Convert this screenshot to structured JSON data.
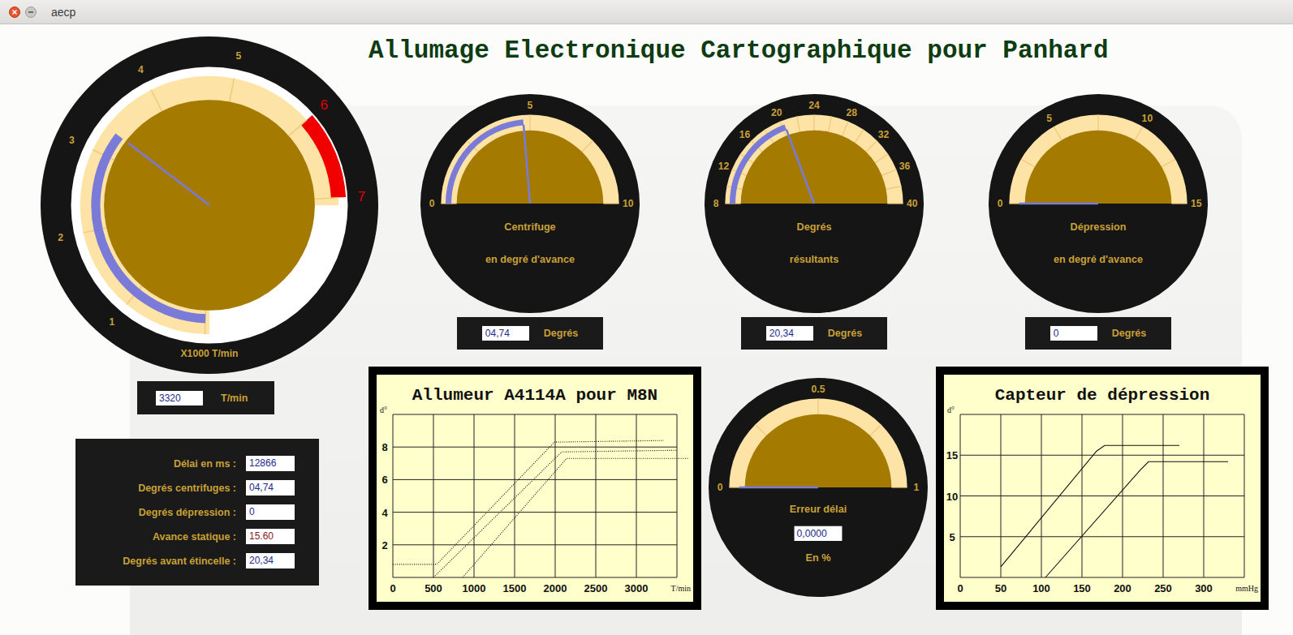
{
  "window": {
    "title": "aecp"
  },
  "title": "Allumage Electronique Cartographique pour Panhard",
  "tachometer": {
    "labels": [
      {
        "text": "1",
        "redline": false
      },
      {
        "text": "2",
        "redline": false
      },
      {
        "text": "3",
        "redline": false
      },
      {
        "text": "4",
        "redline": false
      },
      {
        "text": "5",
        "redline": false
      },
      {
        "text": "6",
        "redline": true
      },
      {
        "text": "7",
        "redline": true
      }
    ],
    "caption": "X1000 T/min",
    "level": 0.474,
    "red_zone": {
      "from_level": 0.857,
      "to_level": 1
    },
    "reading": {
      "value": "3320",
      "unit": "T/min"
    }
  },
  "gauges": [
    {
      "labels": [
        "0",
        "5",
        "10"
      ],
      "caption": [
        "Centrifuge",
        "en degré d'avance"
      ],
      "level": 0.474,
      "reading": {
        "value": "04,74",
        "unit": "Degrés"
      }
    },
    {
      "labels": [
        "8",
        "12",
        "16",
        "20",
        "24",
        "28",
        "32",
        "36",
        "40"
      ],
      "caption": [
        "Degrés",
        "résultants"
      ],
      "level": 0.386,
      "reading": {
        "value": "20,34",
        "unit": "Degrés"
      }
    },
    {
      "labels": [
        "0",
        "5",
        "10",
        "15"
      ],
      "caption": [
        "Dépression",
        "en degré d'avance"
      ],
      "level": 0,
      "reading": {
        "value": "0",
        "unit": "Degrés"
      }
    }
  ],
  "error_gauge": {
    "labels": [
      "0",
      "0.5",
      "1"
    ],
    "caption": "Erreur délai",
    "level": 0,
    "reading": {
      "value": "0,0000",
      "unit": "En %"
    }
  },
  "info_panel": [
    {
      "label": "Délai en ms :",
      "value": "12866",
      "color": "#1c2a8c"
    },
    {
      "label": "Degrés centrifuges :",
      "value": "04,74",
      "color": "#1c2a8c"
    },
    {
      "label": "Degrés dépression :",
      "value": "0",
      "color": "#1c2a8c"
    },
    {
      "label": "Avance statique :",
      "value": "15.60",
      "color": "#8b1a1a"
    },
    {
      "label": "Degrés avant étincelle :",
      "value": "20,34",
      "color": "#1c2a8c"
    }
  ],
  "centrifugal_chart": {
    "title": "Allumeur A4114A pour M8N",
    "y_label": "d°",
    "x_unit": "T/min",
    "x_ticks": [
      "0",
      "500",
      "1000",
      "1500",
      "2000",
      "2500",
      "3000"
    ],
    "y_ticks": [
      "2",
      "4",
      "6",
      "8"
    ],
    "series": [
      {
        "x": [
          0,
          540,
          1990,
          3340
        ],
        "y": [
          0.8,
          0.8,
          8.3,
          8.4
        ]
      },
      {
        "x": [
          500,
          2080,
          3510
        ],
        "y": [
          0,
          7.7,
          7.8
        ]
      },
      {
        "x": [
          860,
          2140,
          3650
        ],
        "y": [
          0,
          7.3,
          7.3
        ]
      }
    ]
  },
  "vacuum_chart": {
    "title": "Capteur de dépression",
    "y_label": "d°",
    "x_unit": "mmHg",
    "x_ticks": [
      "0",
      "50",
      "100",
      "150",
      "200",
      "250",
      "300"
    ],
    "y_ticks": [
      "5",
      "10",
      "15"
    ],
    "series": [
      {
        "x": [
          50,
          168,
          178,
          270
        ],
        "y": [
          1.3,
          15.5,
          16.2,
          16.2
        ]
      },
      {
        "x": [
          105,
          222,
          232,
          330
        ],
        "y": [
          0,
          13.2,
          14.2,
          14.2
        ]
      }
    ]
  }
}
